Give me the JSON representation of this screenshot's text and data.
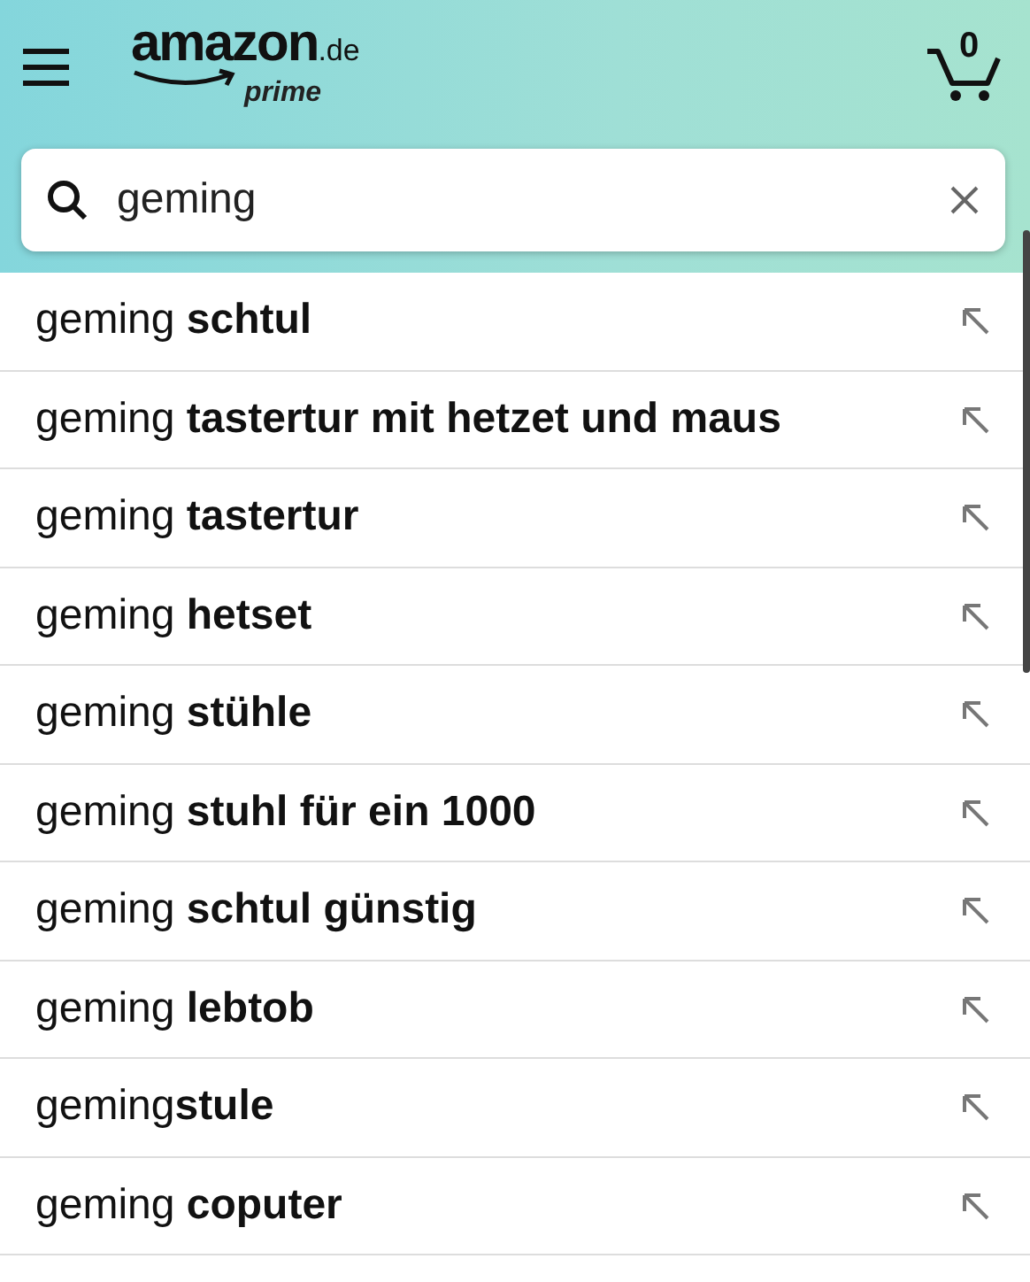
{
  "header": {
    "logo": {
      "brand": "amazon",
      "domain": ".de",
      "tier": "prime"
    },
    "cart_count": "0"
  },
  "search": {
    "value": "geming"
  },
  "suggestions": [
    {
      "text": "geming **schtul**"
    },
    {
      "text": "geming **tastertur mit hetzet und maus**"
    },
    {
      "text": "geming **tastertur**"
    },
    {
      "text": "geming **hetset**"
    },
    {
      "text": "geming **stühle**"
    },
    {
      "text": "geming **stuhl für ein 1000**"
    },
    {
      "text": "geming **schtul günstig**"
    },
    {
      "text": "geming **lebtob**"
    },
    {
      "text": "geming**stule**"
    },
    {
      "text": "geming **coputer**"
    }
  ]
}
